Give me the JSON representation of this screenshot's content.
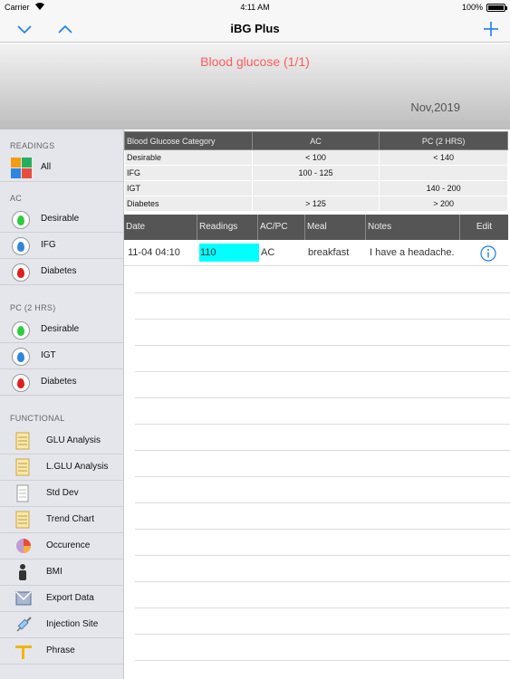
{
  "status_bar": {
    "carrier": "Carrier",
    "time": "4:11 AM",
    "battery": "100%"
  },
  "nav": {
    "title": "iBG Plus",
    "down_icon": "chevron-down-icon",
    "up_icon": "chevron-up-icon",
    "add_icon": "plus-icon",
    "accent_color": "#1a7cf0"
  },
  "header": {
    "title": "Blood glucose (1/1)",
    "date": "Nov,2019",
    "title_color": "#ff5c5c"
  },
  "sidebar": {
    "readings_header": "READINGS",
    "all_label": "All",
    "ac_header": "AC",
    "ac_items": [
      {
        "label": "Desirable",
        "icon": "green-drop-icon"
      },
      {
        "label": "IFG",
        "icon": "blue-drop-icon"
      },
      {
        "label": "Diabetes",
        "icon": "red-drop-icon"
      }
    ],
    "pc_header": "PC (2 HRS)",
    "pc_items": [
      {
        "label": "Desirable",
        "icon": "green-drop-icon"
      },
      {
        "label": "IGT",
        "icon": "blue-drop-icon"
      },
      {
        "label": "Diabetes",
        "icon": "red-drop-icon"
      }
    ],
    "functional_header": "FUNCTIONAL",
    "functional_items": [
      {
        "label": "GLU Analysis",
        "icon": "notepad-icon"
      },
      {
        "label": "L.GLU Analysis",
        "icon": "notepad-icon"
      },
      {
        "label": "Std Dev",
        "icon": "document-icon"
      },
      {
        "label": "Trend Chart",
        "icon": "notepad-icon"
      },
      {
        "label": "Occurence",
        "icon": "pie-chart-icon"
      },
      {
        "label": "BMI",
        "icon": "person-icon"
      },
      {
        "label": "Export Data",
        "icon": "envelope-icon"
      },
      {
        "label": "Injection Site",
        "icon": "syringe-icon"
      },
      {
        "label": "Phrase",
        "icon": "note-icon"
      }
    ]
  },
  "category_table": {
    "headers": [
      "Blood Glucose Category",
      "AC",
      "PC (2 HRS)"
    ],
    "rows": [
      [
        "Desirable",
        "< 100",
        "< 140"
      ],
      [
        "IFG",
        "100 - 125",
        ""
      ],
      [
        "IGT",
        "",
        "140 - 200"
      ],
      [
        "Diabetes",
        "> 125",
        "> 200"
      ]
    ]
  },
  "readings_table": {
    "headers": [
      "Date",
      "Readings",
      "AC/PC",
      "Meal",
      "Notes",
      "Edit"
    ],
    "rows": [
      {
        "date": "11-04  04:10",
        "reading": "110",
        "acpc": "AC",
        "meal": "breakfast",
        "notes": "I have a headache.",
        "edit_icon": "info-icon",
        "reading_color": "#00ffff"
      }
    ]
  }
}
